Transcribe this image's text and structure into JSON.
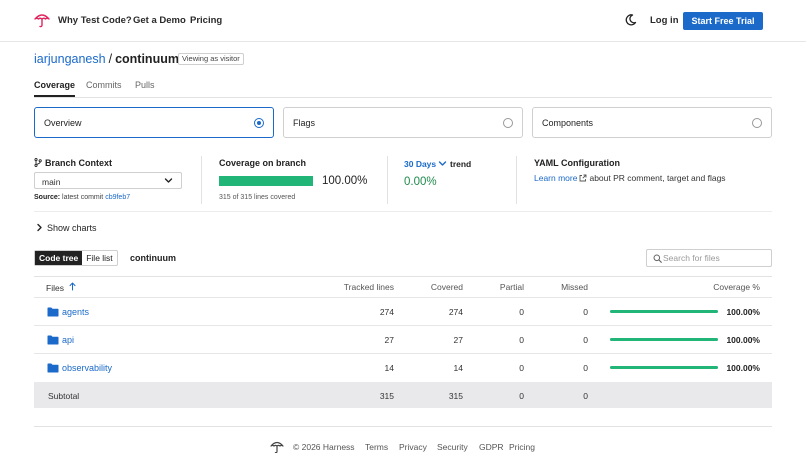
{
  "header": {
    "nav": [
      "Why Test Code?",
      "Get a Demo",
      "Pricing"
    ],
    "login": "Log in",
    "cta": "Start Free Trial"
  },
  "repo": {
    "owner": "iarjunganesh",
    "separator": "/",
    "name": "continuum",
    "visitor_badge": "Viewing as visitor"
  },
  "tabs": [
    "Coverage",
    "Commits",
    "Pulls"
  ],
  "selectors": [
    {
      "label": "Overview",
      "selected": true
    },
    {
      "label": "Flags",
      "selected": false
    },
    {
      "label": "Components",
      "selected": false
    }
  ],
  "summary": {
    "branch_title": "Branch Context",
    "branch": "main",
    "source_label": "Source:",
    "source_text": "latest commit",
    "commit": "cb9feb7",
    "coverage_title": "Coverage on branch",
    "coverage_pct": "100.00%",
    "coverage_fraction": 1.0,
    "lines_covered": "315 of 315 lines covered",
    "trend_days": "30 Days",
    "trend_label": "trend",
    "trend_value": "0.00%",
    "yaml_title": "YAML Configuration",
    "yaml_link": "Learn more",
    "yaml_text": "about PR comment, target and flags"
  },
  "show_charts": "Show charts",
  "view_toggle": {
    "code_tree": "Code tree",
    "file_list": "File list"
  },
  "path_label": "continuum",
  "search": {
    "placeholder": "Search for files"
  },
  "table": {
    "headers": {
      "files": "Files",
      "tracked": "Tracked lines",
      "covered": "Covered",
      "partial": "Partial",
      "missed": "Missed",
      "coverage": "Coverage %"
    },
    "rows": [
      {
        "name": "agents",
        "tracked": "274",
        "covered": "274",
        "partial": "0",
        "missed": "0",
        "pct": "100.00%",
        "fraction": 1.0
      },
      {
        "name": "api",
        "tracked": "27",
        "covered": "27",
        "partial": "0",
        "missed": "0",
        "pct": "100.00%",
        "fraction": 1.0
      },
      {
        "name": "observability",
        "tracked": "14",
        "covered": "14",
        "partial": "0",
        "missed": "0",
        "pct": "100.00%",
        "fraction": 1.0
      }
    ],
    "subtotal": {
      "label": "Subtotal",
      "tracked": "315",
      "covered": "315",
      "partial": "0",
      "missed": "0"
    }
  },
  "footer": {
    "copyright": "© 2026 Harness",
    "links": [
      "Terms",
      "Privacy",
      "Security",
      "GDPR",
      "Pricing"
    ]
  },
  "colors": {
    "accent": "#1b6ac9",
    "coverage_green": "#21b577",
    "trend_green": "#1f8a4c"
  }
}
